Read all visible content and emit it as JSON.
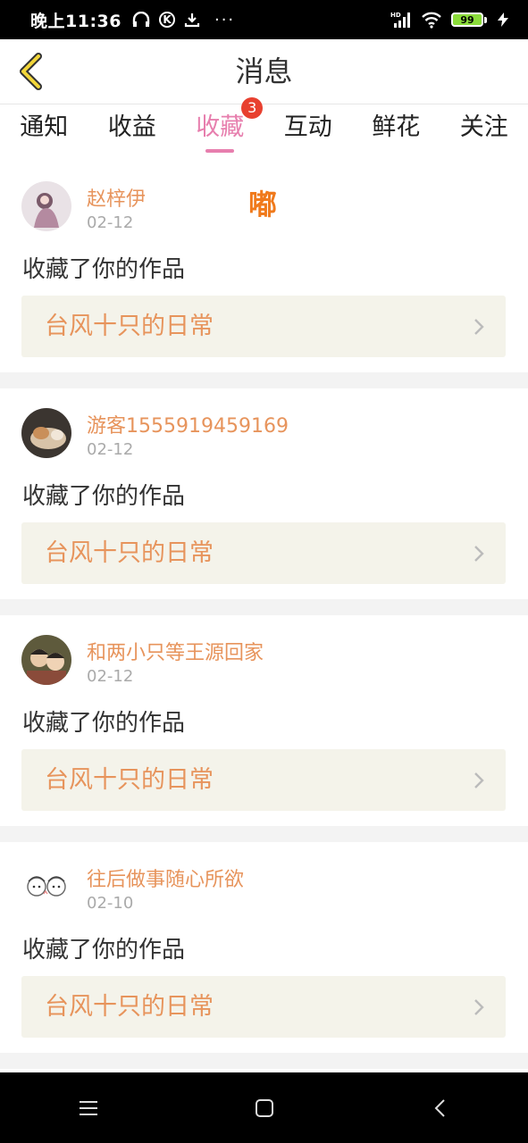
{
  "status_bar": {
    "time": "晚上11:36",
    "k_label": "K",
    "battery": "99",
    "hd_label": "HD"
  },
  "header": {
    "title": "消息",
    "back_icon": "chevron-left-icon"
  },
  "tabs": [
    {
      "label": "通知"
    },
    {
      "label": "收益"
    },
    {
      "label": "收藏",
      "active": true,
      "badge": "3"
    },
    {
      "label": "互动"
    },
    {
      "label": "鲜花"
    },
    {
      "label": "关注"
    }
  ],
  "overlay_text": "嘟",
  "items": [
    {
      "user": "赵梓伊",
      "date": "02-12",
      "action": "收藏了你的作品",
      "work": "台风十只的日常"
    },
    {
      "user": "游客1555919459169",
      "date": "02-12",
      "action": "收藏了你的作品",
      "work": "台风十只的日常"
    },
    {
      "user": "和两小只等王源回家",
      "date": "02-12",
      "action": "收藏了你的作品",
      "work": "台风十只的日常"
    },
    {
      "user": "往后做事随心所欲",
      "date": "02-10",
      "action": "收藏了你的作品",
      "work": "台风十只的日常"
    }
  ],
  "colors": {
    "accent_pink": "#e77fae",
    "username_orange": "#e7945c",
    "badge_red": "#e8402f",
    "card_bg": "#f4f3ea"
  }
}
